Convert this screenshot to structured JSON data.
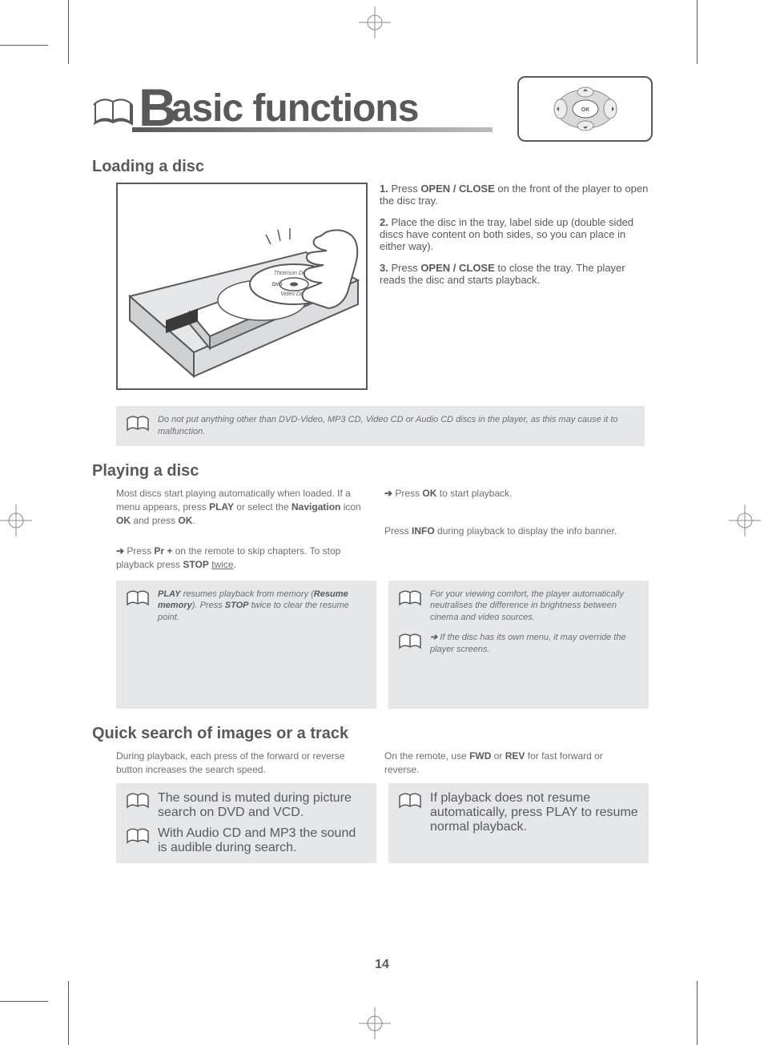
{
  "page_title": "Basic functions",
  "page_number": "14",
  "sections": {
    "loading": {
      "heading": "Loading a disc",
      "steps": [
        {
          "num": "1.",
          "pre": "Press ",
          "bold": "OPEN / CLOSE",
          "post": " on the front of the player to open the disc tray."
        },
        {
          "num": "2.",
          "pre": "Place the disc in the tray, label side up (double sided discs have content on both sides, so you can place in either way).",
          "bold": "",
          "post": ""
        },
        {
          "num": "3.",
          "pre": "Press ",
          "bold": "OPEN / CLOSE",
          "post": " to close the tray. The player reads the disc and starts playback."
        }
      ],
      "note": "Do not put anything other than DVD-Video, MP3 CD, Video CD or Audio CD discs in the player, as this may cause it to malfunction."
    },
    "playing": {
      "heading": "Playing a disc",
      "left": {
        "p1_pre": "Most discs start playing automatically when loaded. If a menu appears, press ",
        "p1_b1": "PLAY",
        "p1_mid": " or select the ",
        "p1_b2": "Navigation",
        "p1_mid2": " icon ",
        "p1_b3": "OK",
        "p1_end": " and press ",
        "p1_b4": "OK",
        "p1_period": ".",
        "p2_arrow": "➔",
        "p2_pre": " Press ",
        "p2_b1": "Pr +",
        "p2_mid": " on the remote to skip chapters. To stop playback press ",
        "p2_b2": "STOP",
        "p2_post": " ",
        "p2_underline": "twice",
        "p2_end": "."
      },
      "right": {
        "p1_arrow": "➔",
        "p1_pre": " Press ",
        "p1_b1": "OK",
        "p1_mid": " to start playback.",
        "p2_pre": "Press ",
        "p2_b1": "INFO",
        "p2_post": " during playback to display the info banner."
      },
      "note_left": {
        "b1": "PLAY",
        "t1": " resumes playback from memory (",
        "b2": "Resume memory",
        "t2": "). Press ",
        "b3": "STOP",
        "t3": " twice to clear the resume point."
      },
      "note_right_1": "For your viewing comfort, the player automatically neutralises the difference in brightness between cinema and video sources.",
      "note_right_2_arrow": "➔",
      "note_right_2": " If the disc has its own menu, it may override the player screens."
    },
    "search": {
      "heading": "Quick search of images or a track",
      "left": "During playback, each press of the forward or reverse button increases the search speed.",
      "right_pre": "On the remote, use ",
      "right_b1": "FWD",
      "right_mid": " or ",
      "right_b2": "REV",
      "right_post": " for fast forward or reverse.",
      "note_left_1": "The sound is muted during picture search on DVD and VCD.",
      "note_left_2": "With Audio CD and MP3 the sound is audible during search.",
      "note_right": "If playback does not resume automatically, press PLAY to resume normal playback."
    }
  }
}
